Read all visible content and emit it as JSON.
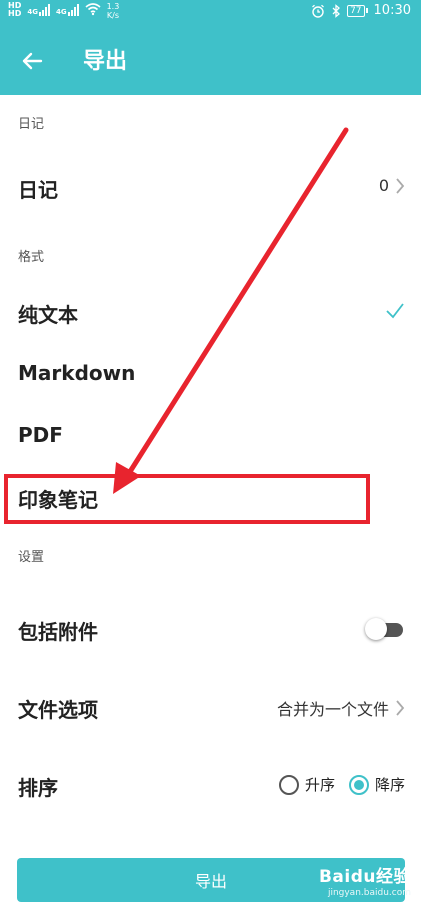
{
  "status_bar": {
    "net_top": "HD",
    "net_bottom": "HD",
    "signal_1": "4G",
    "signal_2": "4G",
    "speed_value": "1.3",
    "speed_unit": "K/s",
    "battery": "77",
    "time": "10:30"
  },
  "header": {
    "title": "导出"
  },
  "sections": {
    "diary": "日记",
    "format": "格式",
    "settings": "设置"
  },
  "diary_row": {
    "label": "日记",
    "count": "0"
  },
  "formats": [
    {
      "label": "纯文本",
      "selected": true
    },
    {
      "label": "Markdown",
      "selected": false
    },
    {
      "label": "PDF",
      "selected": false
    },
    {
      "label": "印象笔记",
      "selected": false
    }
  ],
  "settings": {
    "attachments": {
      "label": "包括附件",
      "enabled": false
    },
    "file_options": {
      "label": "文件选项",
      "value": "合并为一个文件"
    },
    "sort": {
      "label": "排序",
      "options": [
        "升序",
        "降序"
      ],
      "selected": "降序"
    }
  },
  "footer": {
    "export_label": "导出"
  },
  "watermark": {
    "main": "Baidu经验",
    "sub": "jingyan.baidu.com"
  },
  "colors": {
    "accent": "#3fc1c9",
    "annotation": "#e8242e"
  }
}
